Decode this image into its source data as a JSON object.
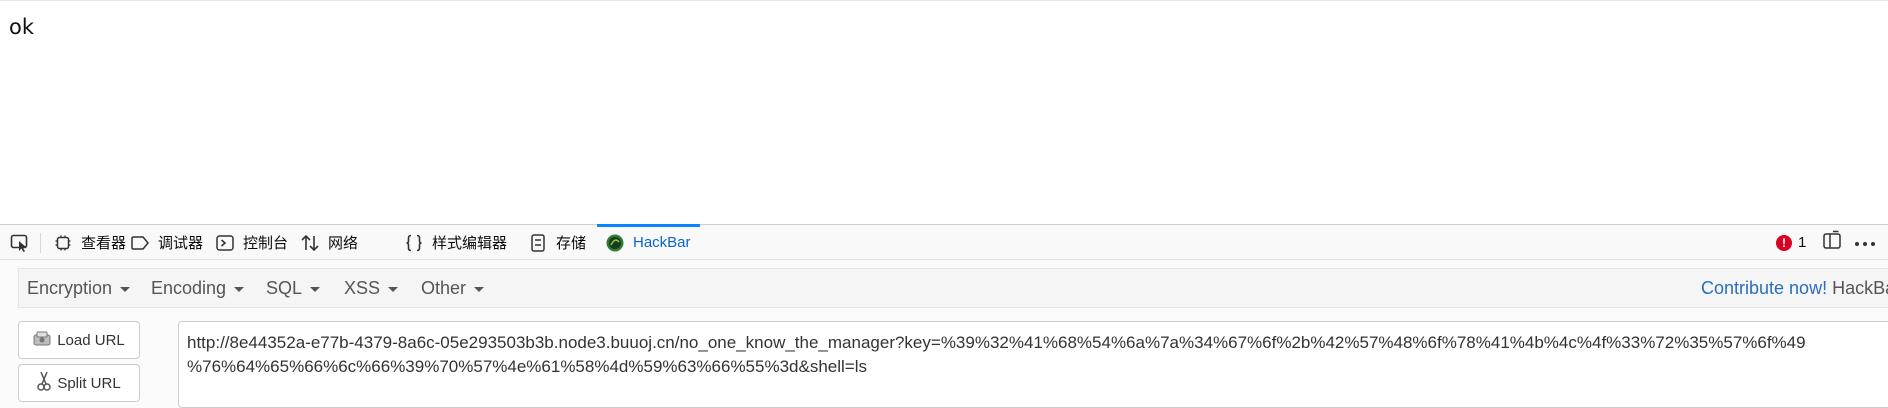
{
  "page": {
    "body_text": "ok"
  },
  "devtools": {
    "tabs": [
      {
        "label": "查看器",
        "icon": "inspector-icon"
      },
      {
        "label": "调试器",
        "icon": "debugger-icon"
      },
      {
        "label": "控制台",
        "icon": "console-icon"
      },
      {
        "label": "网络",
        "icon": "network-icon"
      },
      {
        "label": "样式编辑器",
        "icon": "style-editor-icon"
      },
      {
        "label": "存储",
        "icon": "storage-icon"
      },
      {
        "label": "HackBar",
        "icon": "hackbar-logo-icon"
      }
    ],
    "active_tab": "HackBar",
    "error_count": "1",
    "accent_color": "#0a84ff",
    "error_color": "#d70022"
  },
  "hackbar": {
    "menu": [
      "Encryption",
      "Encoding",
      "SQL",
      "XSS",
      "Other"
    ],
    "contribute_label": "Contribute now!",
    "brand_label": "HackBar v",
    "load_url_label": "Load URL",
    "split_url_label": "Split URL",
    "url_line1": "http://8e44352a-e77b-4379-8a6c-05e293503b3b.node3.buuoj.cn/no_one_know_the_manager?key=%39%32%41%68%54%6a%7a%34%67%6f%2b%42%57%48%6f%78%41%4b%4c%4f%33%72%35%57%6f%49",
    "url_line2": "%76%64%65%66%6c%66%39%70%57%4e%61%58%4d%59%63%66%55%3d&shell=ls"
  }
}
